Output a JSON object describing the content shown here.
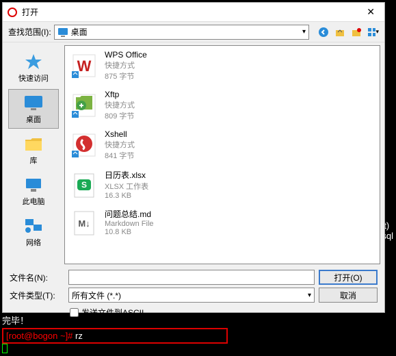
{
  "title": "打开",
  "lookin": {
    "label": "查找范围(I):",
    "value": "桌面"
  },
  "toolbar_icons": [
    "back-icon",
    "up-icon",
    "newfolder-icon",
    "view-icon"
  ],
  "sidebar": {
    "items": [
      {
        "label": "快速访问"
      },
      {
        "label": "桌面"
      },
      {
        "label": "库"
      },
      {
        "label": "此电脑"
      },
      {
        "label": "网络"
      }
    ]
  },
  "files": [
    {
      "name": "WPS Office",
      "type": "快捷方式",
      "size": "875 字节"
    },
    {
      "name": "Xftp",
      "type": "快捷方式",
      "size": "809 字节"
    },
    {
      "name": "Xshell",
      "type": "快捷方式",
      "size": "841 字节"
    },
    {
      "name": "日历表.xlsx",
      "type": "XLSX 工作表",
      "size": "16.3 KB"
    },
    {
      "name": "问题总结.md",
      "type": "Markdown File",
      "size": "10.8 KB"
    }
  ],
  "filename": {
    "label": "文件名(N):",
    "value": ""
  },
  "filetype": {
    "label": "文件类型(T):",
    "value": "所有文件 (*.*)"
  },
  "buttons": {
    "open": "打开(O)",
    "cancel": "取消"
  },
  "ascii": {
    "label": "发送文件到ASCII",
    "checked": false
  },
  "terminal": {
    "line1": "完毕！",
    "prompt": "[root@bogon ~]# ",
    "cmd": "rz"
  },
  "bg": {
    "line1": "it)",
    "line2": "sql"
  }
}
